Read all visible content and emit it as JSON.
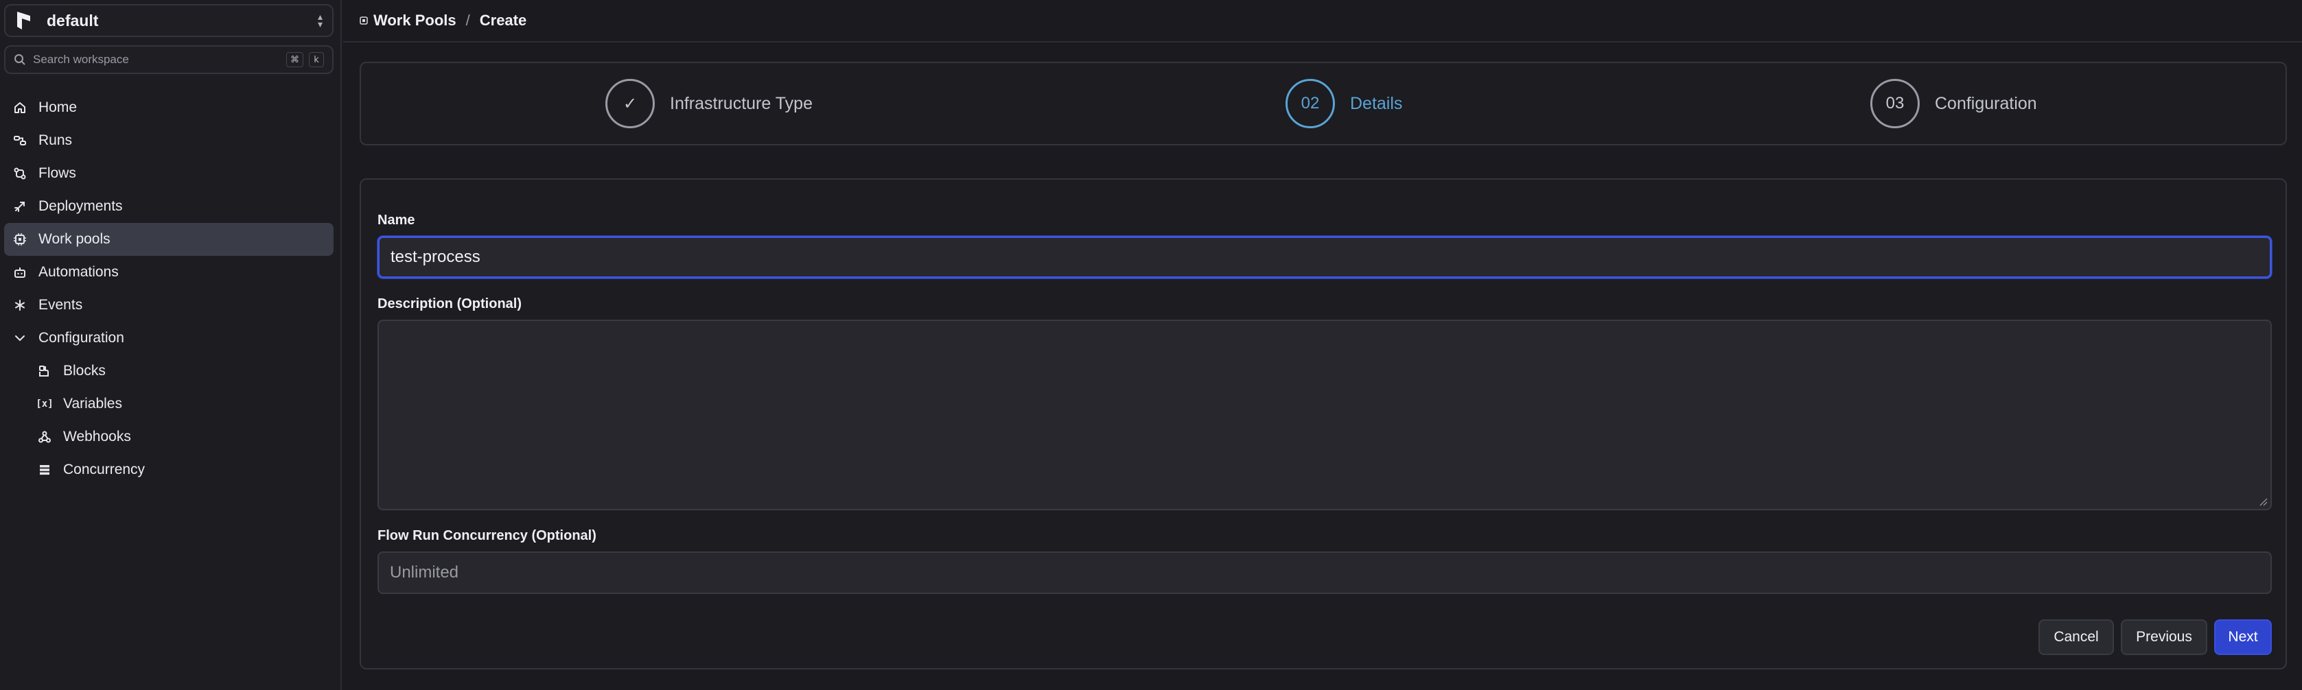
{
  "workspace": {
    "name": "default"
  },
  "search": {
    "placeholder": "Search workspace",
    "kbd_cmd": "⌘",
    "kbd_key": "k"
  },
  "sidebar": {
    "items": [
      {
        "label": "Home",
        "icon": "home-icon"
      },
      {
        "label": "Runs",
        "icon": "runs-icon"
      },
      {
        "label": "Flows",
        "icon": "flows-icon"
      },
      {
        "label": "Deployments",
        "icon": "rocket-icon"
      },
      {
        "label": "Work pools",
        "icon": "cpu-icon",
        "active": true
      },
      {
        "label": "Automations",
        "icon": "bot-icon"
      },
      {
        "label": "Events",
        "icon": "asterisk-icon"
      },
      {
        "label": "Configuration",
        "icon": "chevron-down-icon",
        "expanded": true
      }
    ],
    "sub_items": [
      {
        "label": "Blocks",
        "icon": "blocks-icon"
      },
      {
        "label": "Variables",
        "icon": "variable-icon"
      },
      {
        "label": "Webhooks",
        "icon": "webhook-icon"
      },
      {
        "label": "Concurrency",
        "icon": "stack-icon"
      }
    ]
  },
  "breadcrumb": {
    "parent": "Work Pools",
    "separator": "/",
    "current": "Create"
  },
  "stepper": {
    "steps": [
      {
        "marker": "✓",
        "label": "Infrastructure Type",
        "state": "done"
      },
      {
        "marker": "02",
        "label": "Details",
        "state": "current"
      },
      {
        "marker": "03",
        "label": "Configuration",
        "state": "upcoming"
      }
    ]
  },
  "form": {
    "name_label": "Name",
    "name_value": "test-process",
    "description_label": "Description (Optional)",
    "description_value": "",
    "concurrency_label": "Flow Run Concurrency (Optional)",
    "concurrency_placeholder": "Unlimited"
  },
  "buttons": {
    "cancel": "Cancel",
    "previous": "Previous",
    "next": "Next"
  },
  "colors": {
    "accent": "#3f55d8",
    "step_current": "#5ba3d4",
    "primary_button": "#2f45cf"
  }
}
